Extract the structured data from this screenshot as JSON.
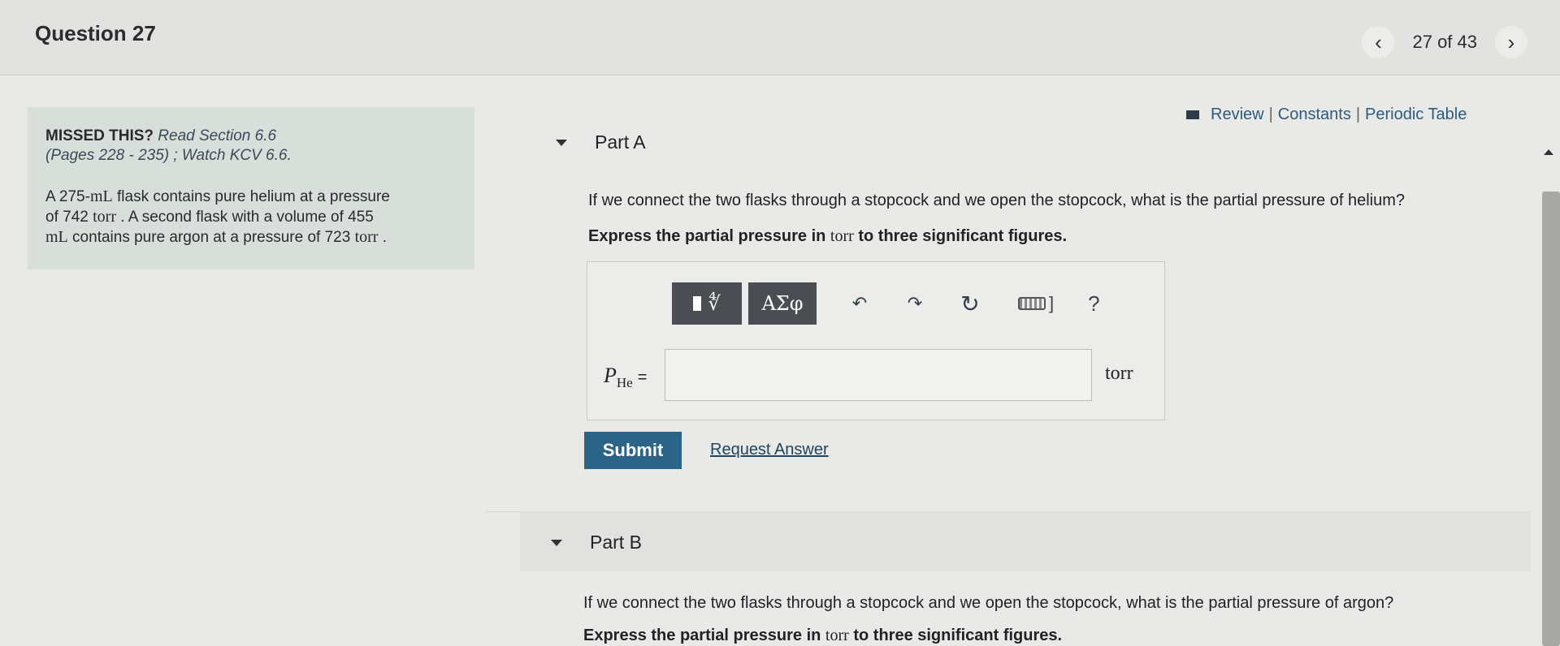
{
  "header": {
    "title": "Question 27",
    "counter": "27 of 43",
    "prev_icon": "chevron-left-icon",
    "next_icon": "chevron-right-icon"
  },
  "top_links": {
    "review": "Review",
    "constants": "Constants",
    "periodic_table": "Periodic Table",
    "separator": "|"
  },
  "sidebar": {
    "missed_label": "MISSED THIS?",
    "read_section": "Read Section 6.6",
    "pages": "(Pages 228 - 235) ; Watch KCV 6.6.",
    "problem": {
      "p1": "A 275-",
      "u_ml": "mL",
      "p2": " flask contains pure helium at a pressure",
      "p3": "of 742 ",
      "u_torr": "torr",
      "p4": " . A second flask with a volume of 455",
      "u_ml2": "mL",
      "p5": " contains pure argon at a pressure of 723 ",
      "u_torr2": "torr",
      "p6": " ."
    }
  },
  "part_a": {
    "label": "Part A",
    "question": "If we connect the two flasks through a stopcock and we open the stopcock, what is the partial pressure of helium?",
    "instruction_pre": "Express the partial pressure in ",
    "instruction_unit": "torr",
    "instruction_post": " to three significant figures.",
    "toolbar": {
      "template_symbol": "∜",
      "greek": "ΑΣφ",
      "undo": "↶",
      "redo": "↷",
      "reset": "↻",
      "keyboard_bracket": "]",
      "help": "?"
    },
    "variable": "P",
    "variable_sub": "He",
    "equals": "=",
    "input_value": "",
    "unit": "torr",
    "submit": "Submit",
    "request_answer": "Request Answer"
  },
  "part_b": {
    "label": "Part B",
    "question": "If we connect the two flasks through a stopcock and we open the stopcock, what is the partial pressure of argon?",
    "instruction_pre": "Express the partial pressure in ",
    "instruction_unit": "torr",
    "instruction_post": " to three significant figures."
  },
  "colors": {
    "submit_bg": "#2b6487",
    "link": "#2d5b80",
    "sidebar_bg": "#d8dfdb",
    "toolbar_bg": "#4a4d52"
  }
}
